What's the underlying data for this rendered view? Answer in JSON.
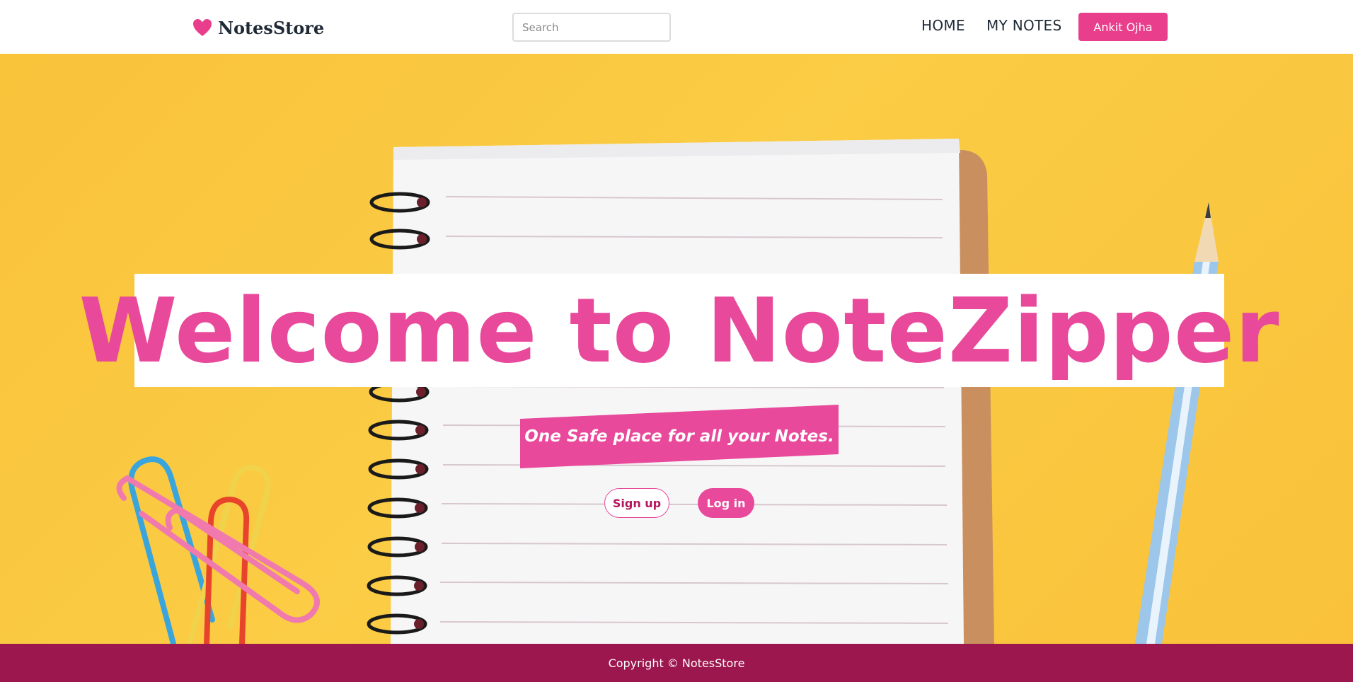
{
  "navbar": {
    "brand": "NotesStore",
    "brand_icon": "heart-icon",
    "search_placeholder": "Search",
    "links": [
      "HOME",
      "MY NOTES"
    ],
    "user_button": "Ankit Ojha"
  },
  "hero": {
    "title": "Welcome to NoteZipper",
    "tagline": "One Safe place for all your Notes.",
    "signup_label": "Sign up",
    "login_label": "Log in"
  },
  "footer": {
    "copyright": "Copyright © NotesStore"
  },
  "colors": {
    "accent": "#e83e8c",
    "title_pink": "#e8499b",
    "footer_bg": "#9c174e",
    "hero_yellow": "#fbcc45"
  }
}
